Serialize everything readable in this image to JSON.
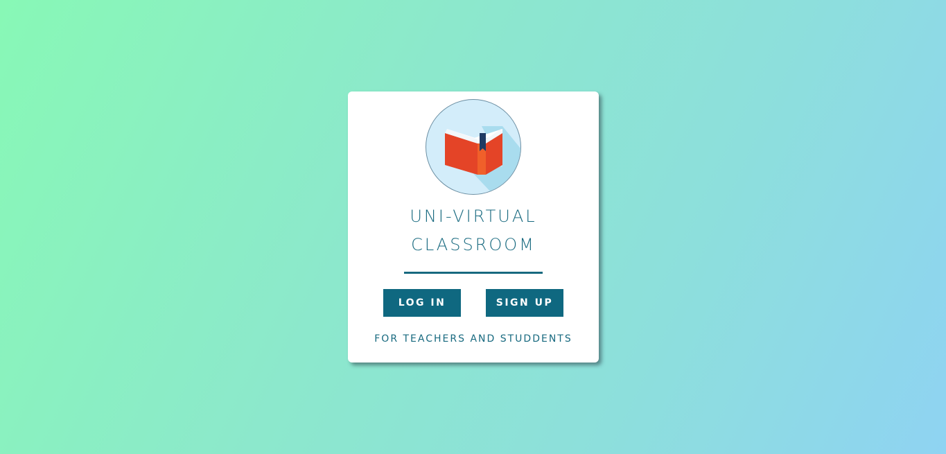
{
  "app": {
    "title_line1": "UNI-VIRTUAL",
    "title_line2": "CLASSROOM",
    "tagline": "FOR TEACHERS AND STUDDENTS",
    "logo_icon": "open-book-icon"
  },
  "actions": {
    "login_label": "LOG IN",
    "signup_label": "SIGN UP"
  },
  "colors": {
    "accent": "#0f6880",
    "text": "#17697f",
    "logo_bg": "#d3edfa",
    "book_red": "#e44427",
    "bookmark": "#1f3b63"
  }
}
